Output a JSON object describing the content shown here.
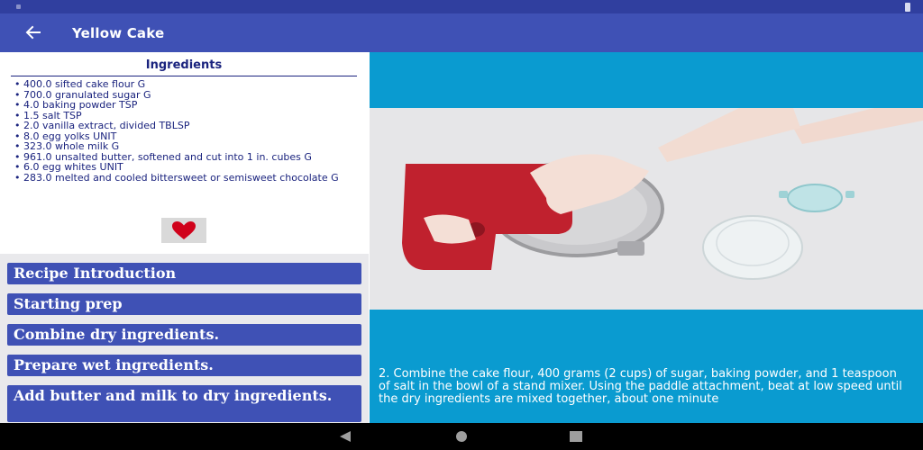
{
  "app": {
    "title": "Yellow Cake",
    "theme_primary": "#3F51B5",
    "theme_dark": "#303F9F"
  },
  "ingredients": {
    "heading": "Ingredients",
    "items": [
      "• 400.0 sifted cake flour G",
      "• 700.0 granulated sugar G",
      "• 4.0 baking powder TSP",
      "• 1.5 salt TSP",
      "• 2.0 vanilla extract, divided TBLSP",
      "• 8.0 egg yolks UNIT",
      "• 323.0 whole milk G",
      "• 961.0 unsalted butter, softened and cut into 1 in. cubes G",
      "• 6.0 egg whites UNIT",
      "• 283.0 melted and cooled bittersweet or semisweet chocolate G"
    ]
  },
  "favorite": {
    "icon": "heart-icon",
    "color": "#d0021b"
  },
  "steps": [
    "Recipe Introduction",
    "Starting prep",
    "Combine dry ingredients.",
    "Prepare wet ingredients.",
    "Add butter and milk to dry ingredients."
  ],
  "detail": {
    "caption": "2. Combine the cake flour, 400 grams (2 cups) of sugar, baking powder, and 1 teaspoon of salt in the bowl of a stand mixer. Using the paddle attachment, beat at low speed until the dry ingredients are mixed together, about one minute",
    "background": "#0a9bd0"
  },
  "navigation": {
    "back": "nav-back-icon",
    "home": "nav-home-icon",
    "recents": "nav-recents-icon"
  }
}
